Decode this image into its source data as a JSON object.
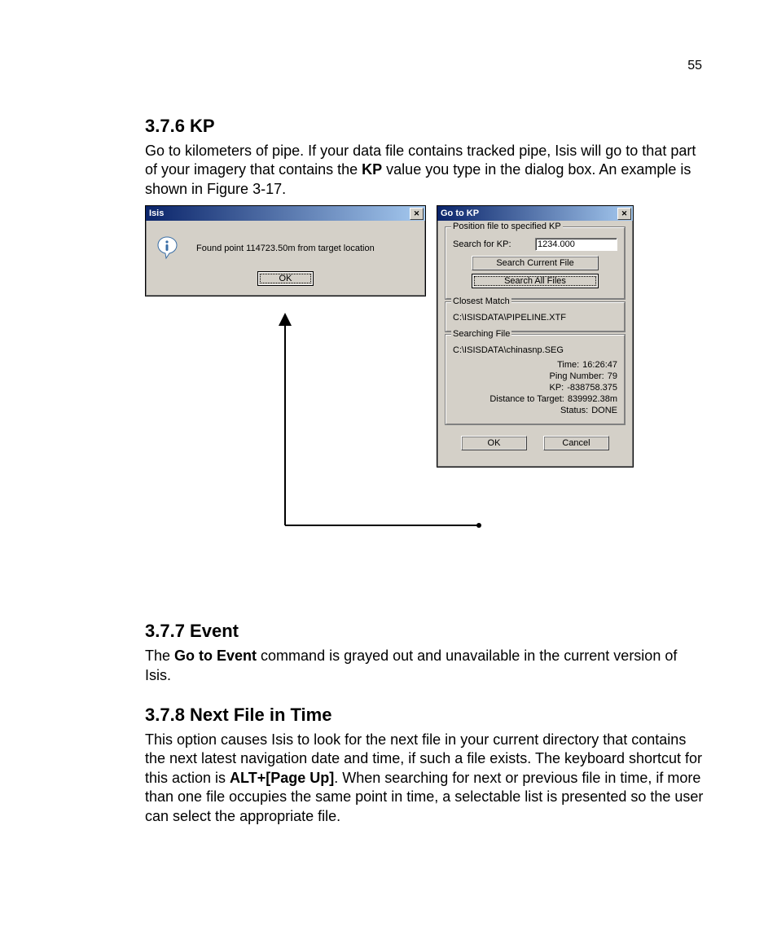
{
  "page_number": "55",
  "section_kp": {
    "heading": "3.7.6 KP",
    "para_parts": {
      "p1": "Go to kilometers of pipe. If your data file contains tracked pipe, Isis will go to that part of your imagery that contains the ",
      "kp_bold": "KP",
      "p2": " value you type in the dialog box. An example is shown in Figure 3-17."
    }
  },
  "dialog_isis": {
    "title": "Isis",
    "message": "Found point 114723.50m from target location",
    "ok_label": "OK"
  },
  "dialog_gotokp": {
    "title": "Go to KP",
    "group_position": {
      "legend": "Position file to specified KP",
      "search_label": "Search for KP:",
      "search_value": "1234.000",
      "btn_current": "Search Current File",
      "btn_all": "Search All Files"
    },
    "group_closest": {
      "legend": "Closest Match",
      "path": "C:\\ISISDATA\\PIPELINE.XTF"
    },
    "group_searching": {
      "legend": "Searching File",
      "path": "C:\\ISISDATA\\chinasnp.SEG",
      "time_label": "Time:",
      "time_value": "16:26:47",
      "ping_label": "Ping Number:",
      "ping_value": "79",
      "kp_label": "KP:",
      "kp_value": "-838758.375",
      "dist_label": "Distance to Target:",
      "dist_value": "839992.38m",
      "status_label": "Status:",
      "status_value": "DONE"
    },
    "ok_label": "OK",
    "cancel_label": "Cancel"
  },
  "section_event": {
    "heading": "3.7.7 Event",
    "para_parts": {
      "p1": "The ",
      "cmd_bold": "Go to Event",
      "p2": " command is grayed out and unavailable in the current version of Isis."
    }
  },
  "section_next": {
    "heading": "3.7.8 Next File in Time",
    "para_parts": {
      "p1": "This option causes Isis to look for the next file in your current directory that contains the next latest navigation date and time, if such a file exists. The keyboard shortcut for this action is ",
      "shortcut_bold": "ALT+[Page Up]",
      "p2": ". When searching for next or previous file in time, if more than one file occupies the same point in time, a selectable list is presented so the user can select the appropriate file."
    }
  }
}
